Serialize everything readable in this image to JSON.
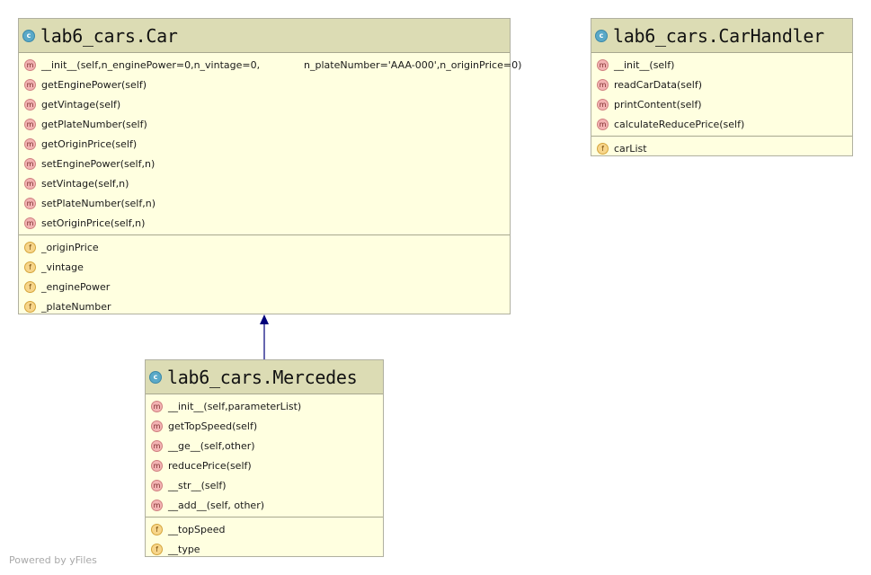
{
  "car": {
    "icon": "class-icon",
    "icon_letter": "c",
    "title": "lab6_cars.Car",
    "methods": [
      "__init__(self,n_enginePower=0,n_vintage=0,              n_plateNumber='AAA-000',n_originPrice=0)",
      "getEnginePower(self)",
      "getVintage(self)",
      "getPlateNumber(self)",
      "getOriginPrice(self)",
      "setEnginePower(self,n)",
      "setVintage(self,n)",
      "setPlateNumber(self,n)",
      "setOriginPrice(self,n)"
    ],
    "fields": [
      "_originPrice",
      "_vintage",
      "_enginePower",
      "_plateNumber"
    ]
  },
  "carhandler": {
    "icon": "class-icon",
    "icon_letter": "c",
    "title": "lab6_cars.CarHandler",
    "methods": [
      "__init__(self)",
      "readCarData(self)",
      "printContent(self)",
      "calculateReducePrice(self)"
    ],
    "fields": [
      "carList"
    ]
  },
  "mercedes": {
    "icon": "class-icon",
    "icon_letter": "c",
    "title": "lab6_cars.Mercedes",
    "methods": [
      "__init__(self,parameterList)",
      "getTopSpeed(self)",
      "__ge__(self,other)",
      "reducePrice(self)",
      "__str__(self)",
      "__add__(self, other)"
    ],
    "fields": [
      "__topSpeed",
      "__type"
    ]
  },
  "badges": {
    "method_letter": "m",
    "field_letter": "f"
  },
  "edges": [
    {
      "from": "lab6_cars.Mercedes",
      "to": "lab6_cars.Car",
      "kind": "inheritance",
      "color": "#00007a"
    }
  ],
  "colors": {
    "header_bg": "#dcdcb4",
    "body_bg": "#ffffe0",
    "class_icon": "#5aa9c8",
    "method_badge": "#f3b3b3",
    "field_badge": "#f7d58a",
    "edge": "#00007a"
  },
  "footer": {
    "text": "Powered by yFiles"
  }
}
